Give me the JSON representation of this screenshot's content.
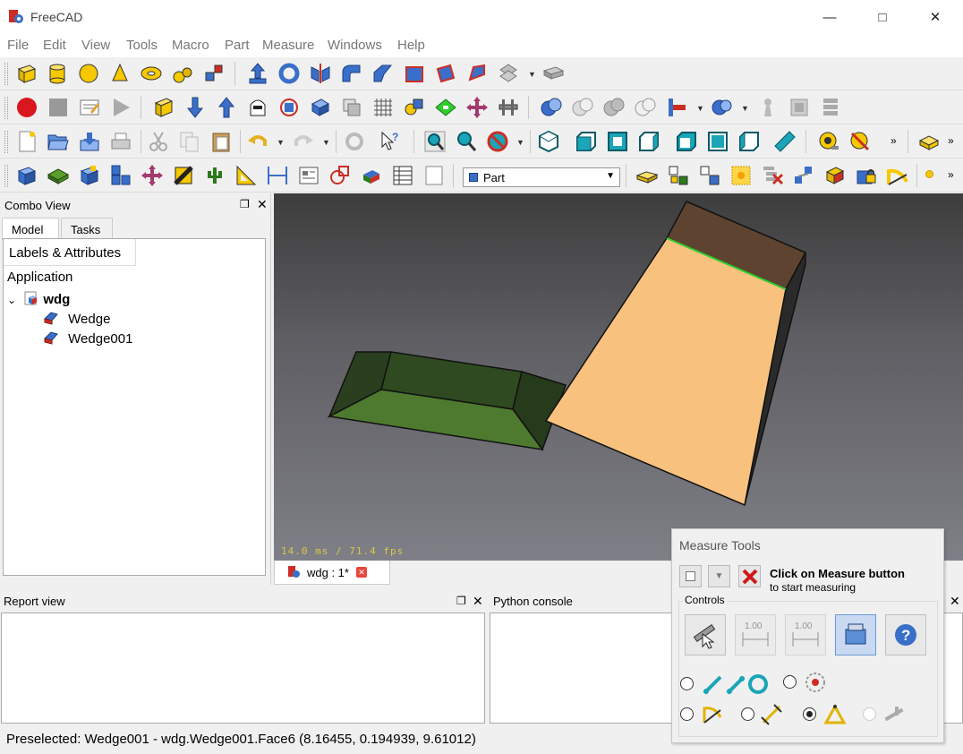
{
  "window": {
    "title": "FreeCAD",
    "minimize_icon": "minimize-icon",
    "maximize_icon": "maximize-icon",
    "close_icon": "close-icon"
  },
  "menu": [
    "File",
    "Edit",
    "View",
    "Tools",
    "Macro",
    "Part",
    "Measure",
    "Windows",
    "Help"
  ],
  "workbench_selector": {
    "value": "Part"
  },
  "combo_view": {
    "title": "Combo View",
    "tabs": [
      "Model",
      "Tasks"
    ],
    "tree_header": "Labels & Attributes",
    "tree": {
      "root": "Application",
      "document": "wdg",
      "objects": [
        "Wedge",
        "Wedge001"
      ]
    }
  },
  "view3d": {
    "fps": "14.0 ms / 71.4 fps",
    "doc_tab": "wdg : 1*",
    "background_top": "#3d3d3d",
    "background_bottom": "#7f7f87"
  },
  "report_view": {
    "title": "Report view"
  },
  "python_console": {
    "title": "Python console"
  },
  "status_bar": {
    "text": "Preselected: Wedge001 - wdg.Wedge001.Face6 (8.16455, 0.194939, 9.61012)"
  },
  "measure_tools": {
    "title": "Measure Tools",
    "message_bold": "Click on Measure button",
    "message": "to start measuring",
    "controls_label": "Controls",
    "big_buttons": [
      "measure-tool-icon",
      "dimension-1-icon",
      "dimension-2-icon",
      "clear-icon",
      "help-icon"
    ],
    "modes": [
      {
        "icon": "edge-to-edge-icon",
        "selected": false
      },
      {
        "icon": "circle-icon",
        "selected": false
      },
      {
        "icon": "angle-icon",
        "selected": false
      },
      {
        "icon": "distance-icon",
        "selected": false
      },
      {
        "icon": "angle-3pt-icon",
        "selected": true
      },
      {
        "icon": "disabled-mode-icon",
        "selected": false
      }
    ],
    "dimension_label": "1.00"
  },
  "colors": {
    "accent_red": "#cc2e25",
    "blue_icon": "#3a6fc9",
    "face_orange": "#f8c27e",
    "wedge_green": "#3b6a22"
  }
}
